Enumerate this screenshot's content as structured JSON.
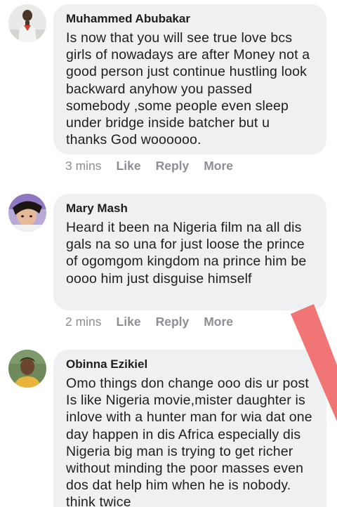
{
  "comments": [
    {
      "author": "Muhammed Abubakar",
      "text": "Is now that you will see true love bcs girls of nowadays are after Money not a good person just continue hustling look backward anyhow you passed somebody ,some people even sleep under bridge inside batcher but u thanks God woooooo.",
      "time": "3 mins",
      "like": "Like",
      "reply": "Reply",
      "more": "More"
    },
    {
      "author": "Mary Mash",
      "text": "Heard it been na Nigeria film na all dis gals na so una for just loose the prince of ogomgom kingdom na prince him be oooo him just disguise himself",
      "time": "2 mins",
      "like": "Like",
      "reply": "Reply",
      "more": "More"
    },
    {
      "author": "Obinna Ezikiel",
      "text": "Omo things don change ooo dis ur post Is like Nigeria movie,mister daughter is inlove with a hunter man for wia dat one day happen in dis Africa especially dis Nigeria big man is trying to get richer without minding the poor masses even dos dat help him when he is nobody. think twice"
    }
  ],
  "colors": {
    "bubble": "#eff0f2",
    "text": "#1c1e21",
    "meta": "#8c8f94",
    "annotation_line": "#f06e6e"
  }
}
